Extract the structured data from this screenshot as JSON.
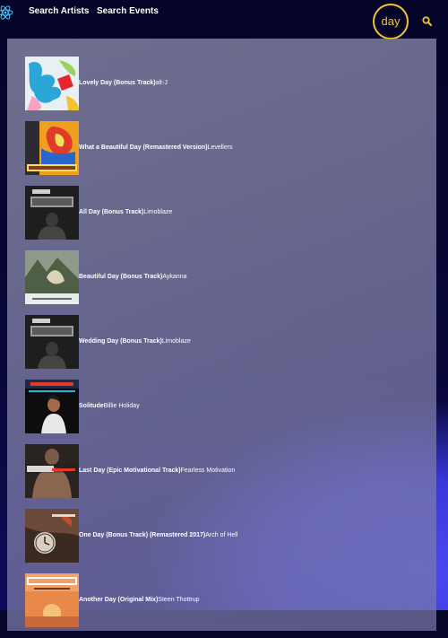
{
  "nav": {
    "search_artists": "Search Artists",
    "search_events": "Search Events",
    "query": "day"
  },
  "colors": {
    "accent": "#f2c230",
    "panel": "#8c8caa",
    "glow": "#4a48f2"
  },
  "results": [
    {
      "title": "Lovely Day (Bonus Track)",
      "artist": "alt-J",
      "cover_icon": "album-cover-alt-j"
    },
    {
      "title": "What a Beautiful Day (Remastered Version)",
      "artist": "Levellers",
      "cover_icon": "album-cover-levellers"
    },
    {
      "title": "All Day (Bonus Track)",
      "artist": "Limoblaze",
      "cover_icon": "album-cover-blind"
    },
    {
      "title": "Beautiful Day (Bonus Track)",
      "artist": "Aykanna",
      "cover_icon": "album-cover-aykanna"
    },
    {
      "title": "Wedding Day (Bonus Track)",
      "artist": "Limoblaze",
      "cover_icon": "album-cover-blind"
    },
    {
      "title": "Solitude",
      "artist": "Billie Holiday",
      "cover_icon": "album-cover-billie-holiday"
    },
    {
      "title": "Last Day (Epic Motivational Track)",
      "artist": "Fearless Motivation",
      "cover_icon": "album-cover-hungry"
    },
    {
      "title": "One Day (Bonus Track) (Remastered 2017)",
      "artist": "Arch of Hell",
      "cover_icon": "album-cover-arch-of-hell"
    },
    {
      "title": "Another Day (Original Mix)",
      "artist": "Steen Thottrup",
      "cover_icon": "album-cover-another-day"
    }
  ]
}
